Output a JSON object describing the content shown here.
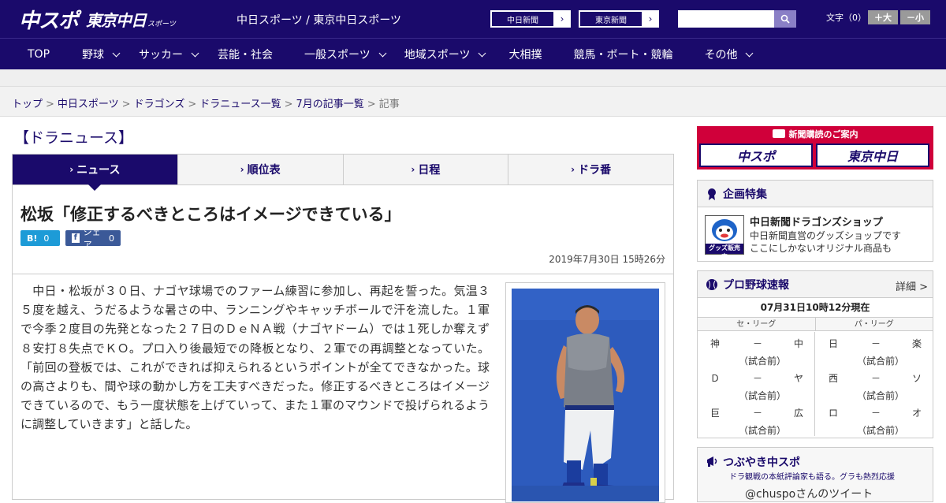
{
  "header": {
    "logo_main": "中スポ",
    "logo_sub": "東京中日",
    "logo_small": "スポーツ",
    "title": "中日スポーツ / 東京中日スポーツ",
    "ext_buttons": [
      {
        "label": "中日新聞",
        "arrow": "›"
      },
      {
        "label": "東京新聞",
        "arrow": "›"
      }
    ],
    "search_placeholder": "",
    "text_size_label": "文字（0）",
    "size_up": "＋大",
    "size_down": "－小"
  },
  "nav": {
    "items": [
      {
        "label": "TOP",
        "dropdown": false
      },
      {
        "label": "野球",
        "dropdown": true
      },
      {
        "label": "サッカー",
        "dropdown": true
      },
      {
        "label": "芸能・社会",
        "dropdown": false
      },
      {
        "label": "一般スポーツ",
        "dropdown": true
      },
      {
        "label": "地域スポーツ",
        "dropdown": true
      },
      {
        "label": "大相撲",
        "dropdown": false
      },
      {
        "label": "競馬・ボート・競輪",
        "dropdown": false
      },
      {
        "label": "その他",
        "dropdown": true
      }
    ]
  },
  "breadcrumb": {
    "links": [
      "トップ",
      "中日スポーツ",
      "ドラゴンズ",
      "ドラニュース一覧",
      "7月の記事一覧"
    ],
    "current": "記事",
    "sep": ">"
  },
  "main": {
    "section_title": "【ドラニュース】",
    "tabs": [
      {
        "label": "ニュース",
        "active": true
      },
      {
        "label": "順位表",
        "active": false
      },
      {
        "label": "日程",
        "active": false
      },
      {
        "label": "ドラ番",
        "active": false
      }
    ],
    "headline": "松坂「修正するべきところはイメージできている」",
    "hatena_label": "B!",
    "hatena_count": "0",
    "fb_label": "シェア",
    "fb_count": "0",
    "date": "2019年7月30日 15時26分",
    "body": "　中日・松坂が３０日、ナゴヤ球場でのファーム練習に参加し、再起を誓った。気温３５度を越え、うだるような暑さの中、ランニングやキャッチボールで汗を流した。１軍で今季２度目の先発となった２７日のＤｅＮＡ戦（ナゴヤドーム）では１死しか奪えず８安打８失点でＫＯ。プロ入り後最短での降板となり、２軍での再調整となっていた。「前回の登板では、これができれば抑えられるというポイントが全てできなかった。球の高さよりも、間や球の動かし方を工夫すべきだった。修正するべきところはイメージできているので、もう一度状態を上げていって、また１軍のマウンドで投げられるように調整していきます」と話した。"
  },
  "sidebar": {
    "subscribe_title": "新聞購読のご案内",
    "subscribe_logos": [
      "中スポ",
      "東京中日"
    ],
    "kikaku_title": "企画特集",
    "shop_title": "中日新聞ドラゴンズショップ",
    "shop_desc1": "中日新聞直営のグッズショップです",
    "shop_desc2": "ここにしかないオリジナル商品も",
    "shop_badge": "グッズ販売中",
    "sokuho_title": "プロ野球速報",
    "sokuho_more": "詳細 >",
    "as_of": "07月31日10時12分現在",
    "central": "セ・リーグ",
    "pacific": "パ・リーグ",
    "central_games": [
      {
        "home": "神",
        "score": "－",
        "away": "中",
        "status": "（試合前）"
      },
      {
        "home": "Ｄ",
        "score": "－",
        "away": "ヤ",
        "status": "（試合前）"
      },
      {
        "home": "巨",
        "score": "－",
        "away": "広",
        "status": "（試合前）"
      }
    ],
    "pacific_games": [
      {
        "home": "日",
        "score": "－",
        "away": "楽",
        "status": "（試合前）"
      },
      {
        "home": "西",
        "score": "－",
        "away": "ソ",
        "status": "（試合前）"
      },
      {
        "home": "ロ",
        "score": "－",
        "away": "オ",
        "status": "（試合前）"
      }
    ],
    "tsubu_title": "つぶやき中スポ",
    "tsubu_sub": "ドラ観戦の本紙評論家も語る。グラも熱烈応援",
    "tsubu_account": "@chuspoさんのツイート"
  },
  "colors": {
    "brand": "#1a0a6b",
    "accent_red": "#d0003a",
    "hatena": "#1d9bd7",
    "facebook": "#3b5998"
  }
}
